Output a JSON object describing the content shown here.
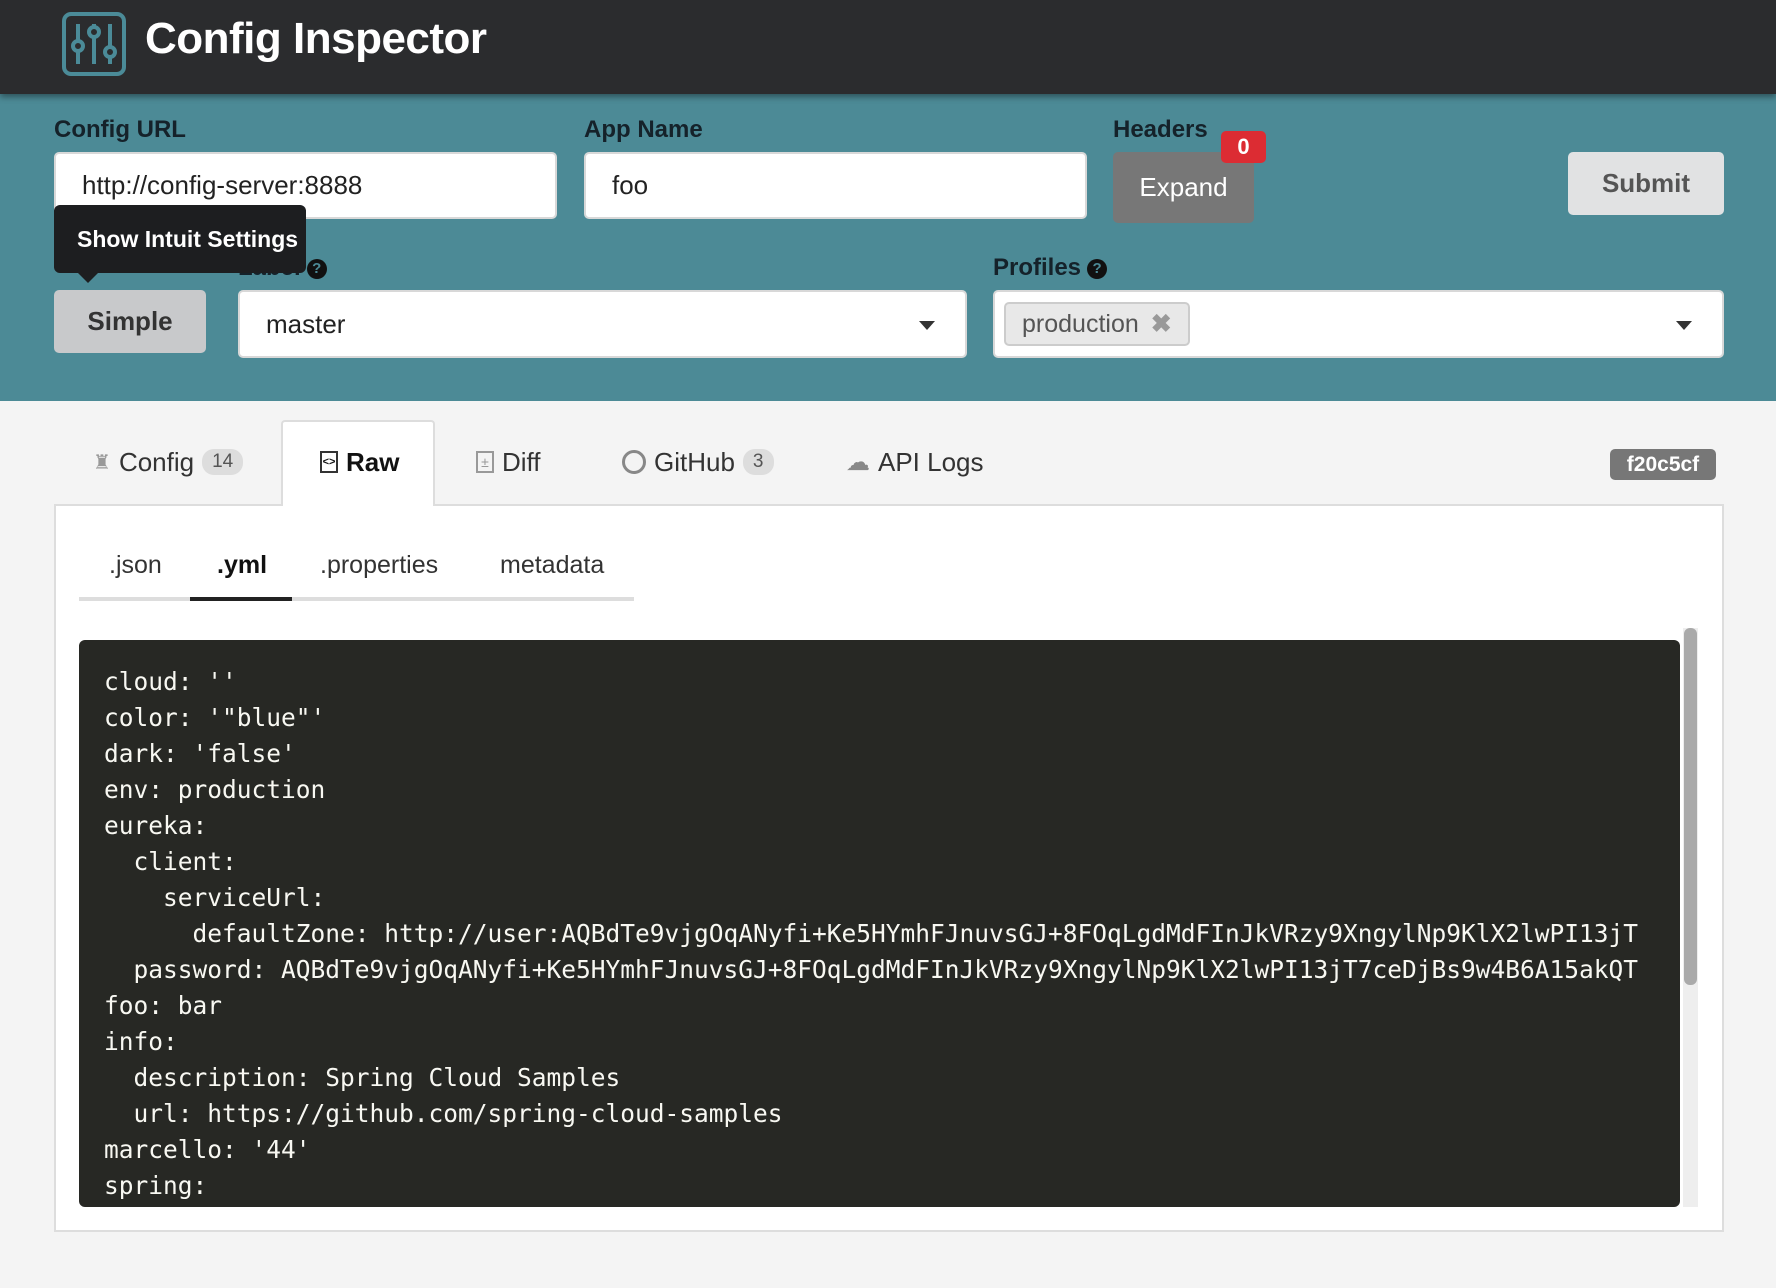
{
  "app": {
    "title": "Config Inspector",
    "logo_icon": "sliders-icon"
  },
  "form": {
    "config_url": {
      "label": "Config URL",
      "value": "http://config-server:8888"
    },
    "app_name": {
      "label": "App Name",
      "value": "foo"
    },
    "headers": {
      "label": "Headers",
      "button": "Expand",
      "count": "0"
    },
    "submit": "Submit",
    "mode_button": "Simple",
    "tooltip": "Show Intuit Settings",
    "label": {
      "label": "Label",
      "value": "master"
    },
    "profiles": {
      "label": "Profiles",
      "selected": [
        "production"
      ]
    }
  },
  "tabs": [
    {
      "label": "Config",
      "count": "14",
      "icon": "sitemap-icon"
    },
    {
      "label": "Raw",
      "icon": "file-code-icon",
      "active": true
    },
    {
      "label": "Diff",
      "icon": "file-diff-icon"
    },
    {
      "label": "GitHub",
      "count": "3",
      "icon": "github-icon"
    },
    {
      "label": "API Logs",
      "icon": "cloud-icon"
    }
  ],
  "commit": "f20c5cf",
  "subtabs": [
    {
      "label": ".json"
    },
    {
      "label": ".yml",
      "active": true
    },
    {
      "label": ".properties"
    },
    {
      "label": "metadata"
    }
  ],
  "code_lines": [
    "cloud: ''",
    "color: '\"blue\"'",
    "dark: 'false'",
    "env: production",
    "eureka:",
    "  client:",
    "    serviceUrl:",
    "      defaultZone: http://user:AQBdTe9vjgOqANyfi+Ke5HYmhFJnuvsGJ+8FOqLgdMdFInJkVRzy9XngylNp9KlX2lwPI13jT",
    "  password: AQBdTe9vjgOqANyfi+Ke5HYmhFJnuvsGJ+8FOqLgdMdFInJkVRzy9XngylNp9KlX2lwPI13jT7ceDjBs9w4B6A15akQT",
    "foo: bar",
    "info:",
    "  description: Spring Cloud Samples",
    "  url: https://github.com/spring-cloud-samples",
    "marcello: '44'",
    "spring:"
  ],
  "colors": {
    "header": "#2b2c2e",
    "form_bg": "#4c8a96",
    "badge": "#dc2c33",
    "code_bg": "#272824"
  }
}
